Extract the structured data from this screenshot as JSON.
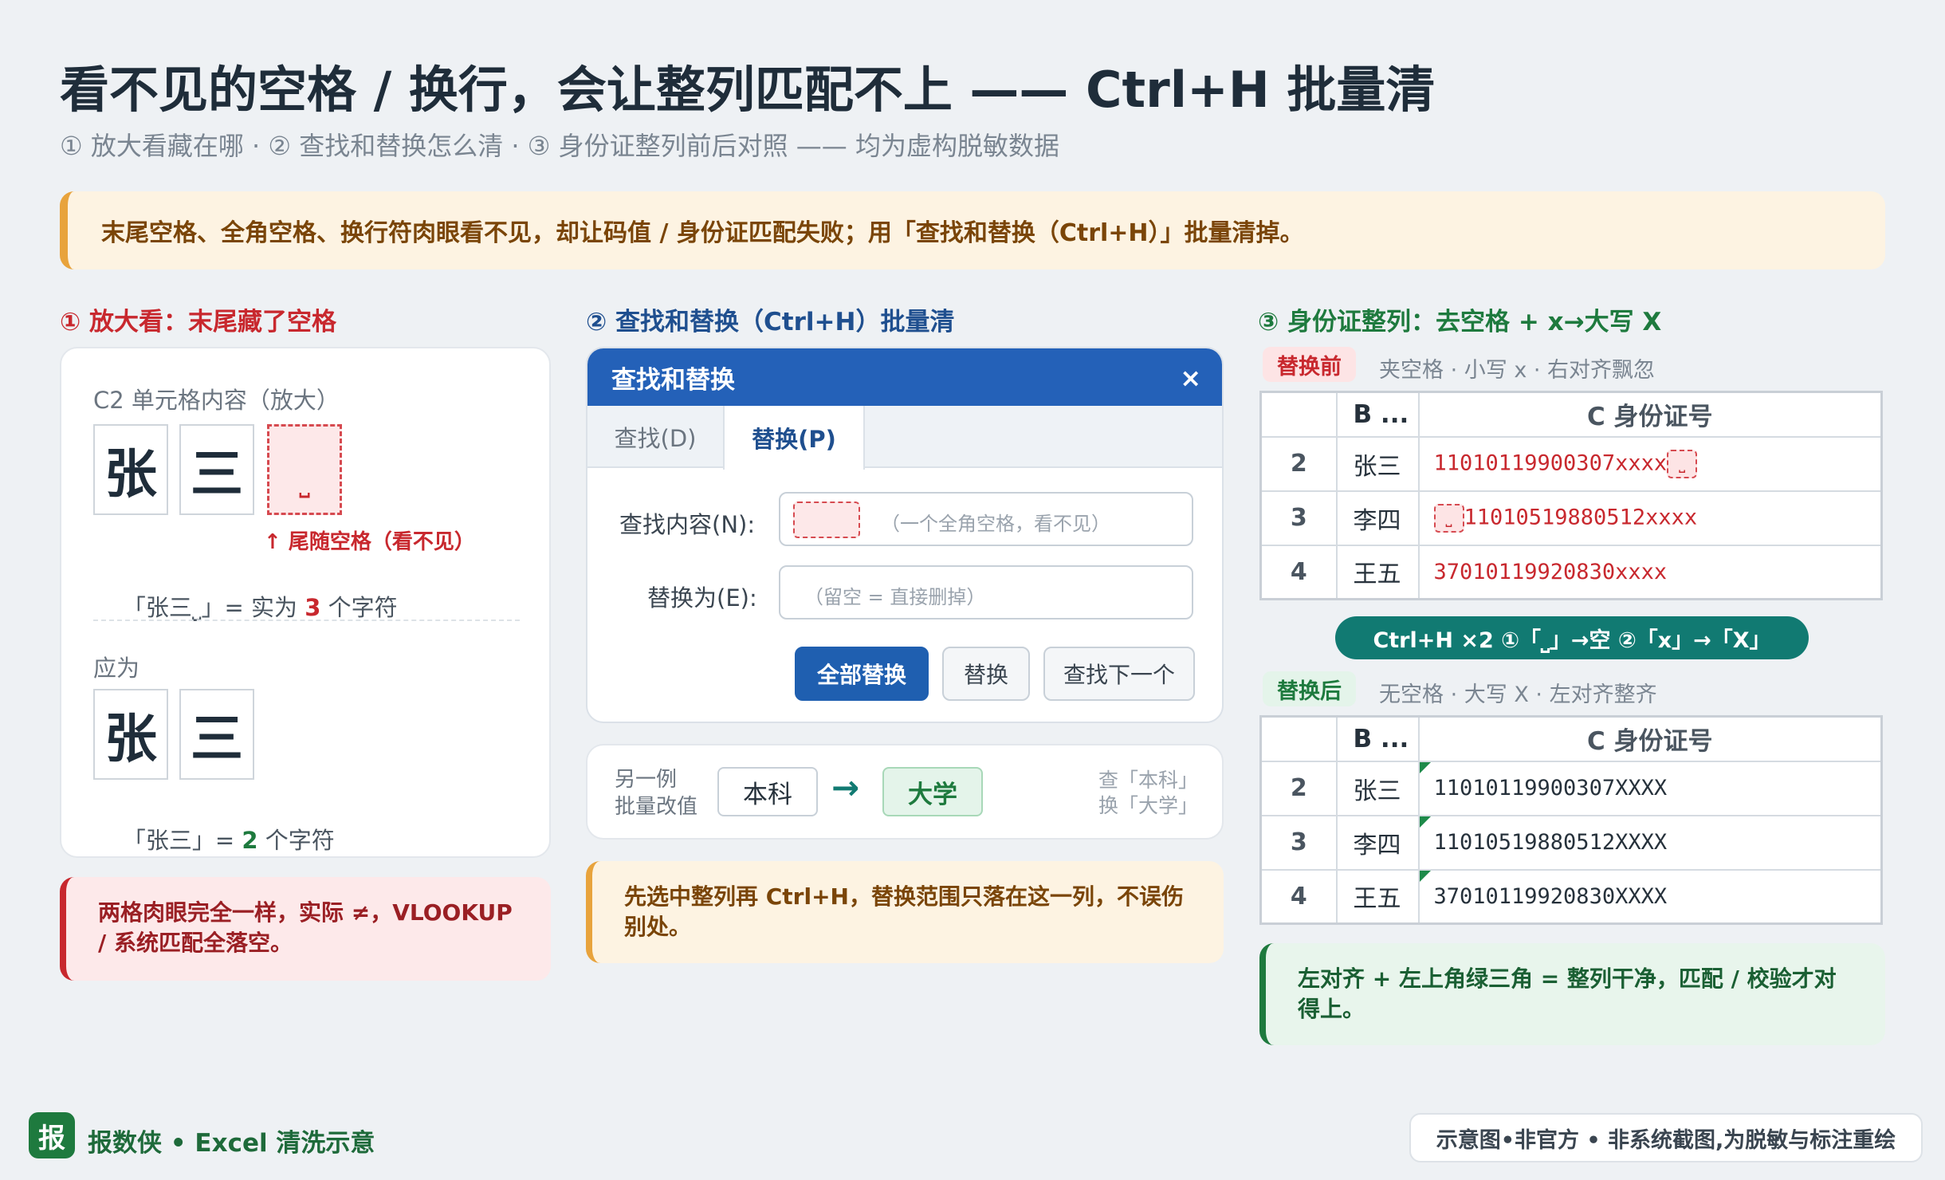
{
  "header": {
    "title": "看不见的空格 / 换行，会让整列匹配不上 —— Ctrl+H 批量清",
    "subtitle": "① 放大看藏在哪   ·   ② 查找和替换怎么清   ·   ③ 身份证整列前后对照 —— 均为虚构脱敏数据"
  },
  "banner": "末尾空格、全角空格、换行符肉眼看不见，却让码值 / 身份证匹配失败；用「查找和替换（Ctrl+H）」批量清掉。",
  "section1": {
    "heading": "① 放大看：末尾藏了空格",
    "card_label": "C2 单元格内容（放大）",
    "chars": [
      "张",
      "三"
    ],
    "space_glyph": "⎵",
    "space_note": "↑ 尾随空格（看不见）",
    "count_prefix": "「张三⎵」= 实为 ",
    "count_num": "3",
    "count_suffix": " 个字符",
    "should_label": "应为",
    "correct_chars": [
      "张",
      "三"
    ],
    "correct_prefix": "「张三」= ",
    "correct_num": "2",
    "correct_suffix": " 个字符",
    "warning": "两格肉眼完全一样，实际 ≠，VLOOKUP / 系统匹配全落空。"
  },
  "section2": {
    "heading": "② 查找和替换（Ctrl+H）批量清",
    "dialog": {
      "title": "查找和替换",
      "close": "×",
      "tab_find": "查找(D)",
      "tab_replace": "替换(P)",
      "find_label": "查找内容(N):",
      "find_hint": "（一个全角空格，看不见）",
      "replace_label": "替换为(E):",
      "replace_placeholder": "（留空 = 直接删掉）",
      "btn_replace_all": "全部替换",
      "btn_replace": "替换",
      "btn_find_next": "查找下一个"
    },
    "example": {
      "label": "另一例\n批量改值",
      "from": "本科",
      "arrow": "→",
      "to": "大学",
      "hint": "查「本科」\n换「大学」"
    },
    "tip": "先选中整列再 Ctrl+H，替换范围只落在这一列，不误伤别处。"
  },
  "section3": {
    "heading": "③ 身份证整列：去空格 + x→大写 X",
    "before_tag": "替换前",
    "before_desc": "夹空格 · 小写 x · 右对齐飘忽",
    "after_tag": "替换后",
    "after_desc": "无空格 · 大写 X · 左对齐整齐",
    "col_b": "B ...",
    "col_c": "C 身份证号",
    "before_rows": [
      {
        "n": "2",
        "name": "张三",
        "id": "11010119900307xxxx",
        "space": "after"
      },
      {
        "n": "3",
        "name": "李四",
        "id": "11010519880512xxxx",
        "space": "before"
      },
      {
        "n": "4",
        "name": "王五",
        "id": "37010119920830xxxx",
        "space": "none"
      }
    ],
    "after_rows": [
      {
        "n": "2",
        "name": "张三",
        "id": "11010119900307XXXX"
      },
      {
        "n": "3",
        "name": "李四",
        "id": "11010519880512XXXX"
      },
      {
        "n": "4",
        "name": "王五",
        "id": "37010119920830XXXX"
      }
    ],
    "pill": "Ctrl+H ×2   ①「⎵」→空   ②「x」→「X」",
    "conclusion": "左对齐 + 左上角绿三角 = 整列干净，匹配 / 校验才对得上。"
  },
  "footer": {
    "logo": "报",
    "brand": "报数侠 • Excel 清洗示意",
    "disclaimer": "示意图•非官方 • 非系统截图,为脱敏与标注重绘"
  },
  "colors": {
    "red": "#c8282e",
    "blue": "#2461b8",
    "green": "#1e7a3e",
    "teal": "#117a72",
    "amber": "#e8a33c"
  }
}
